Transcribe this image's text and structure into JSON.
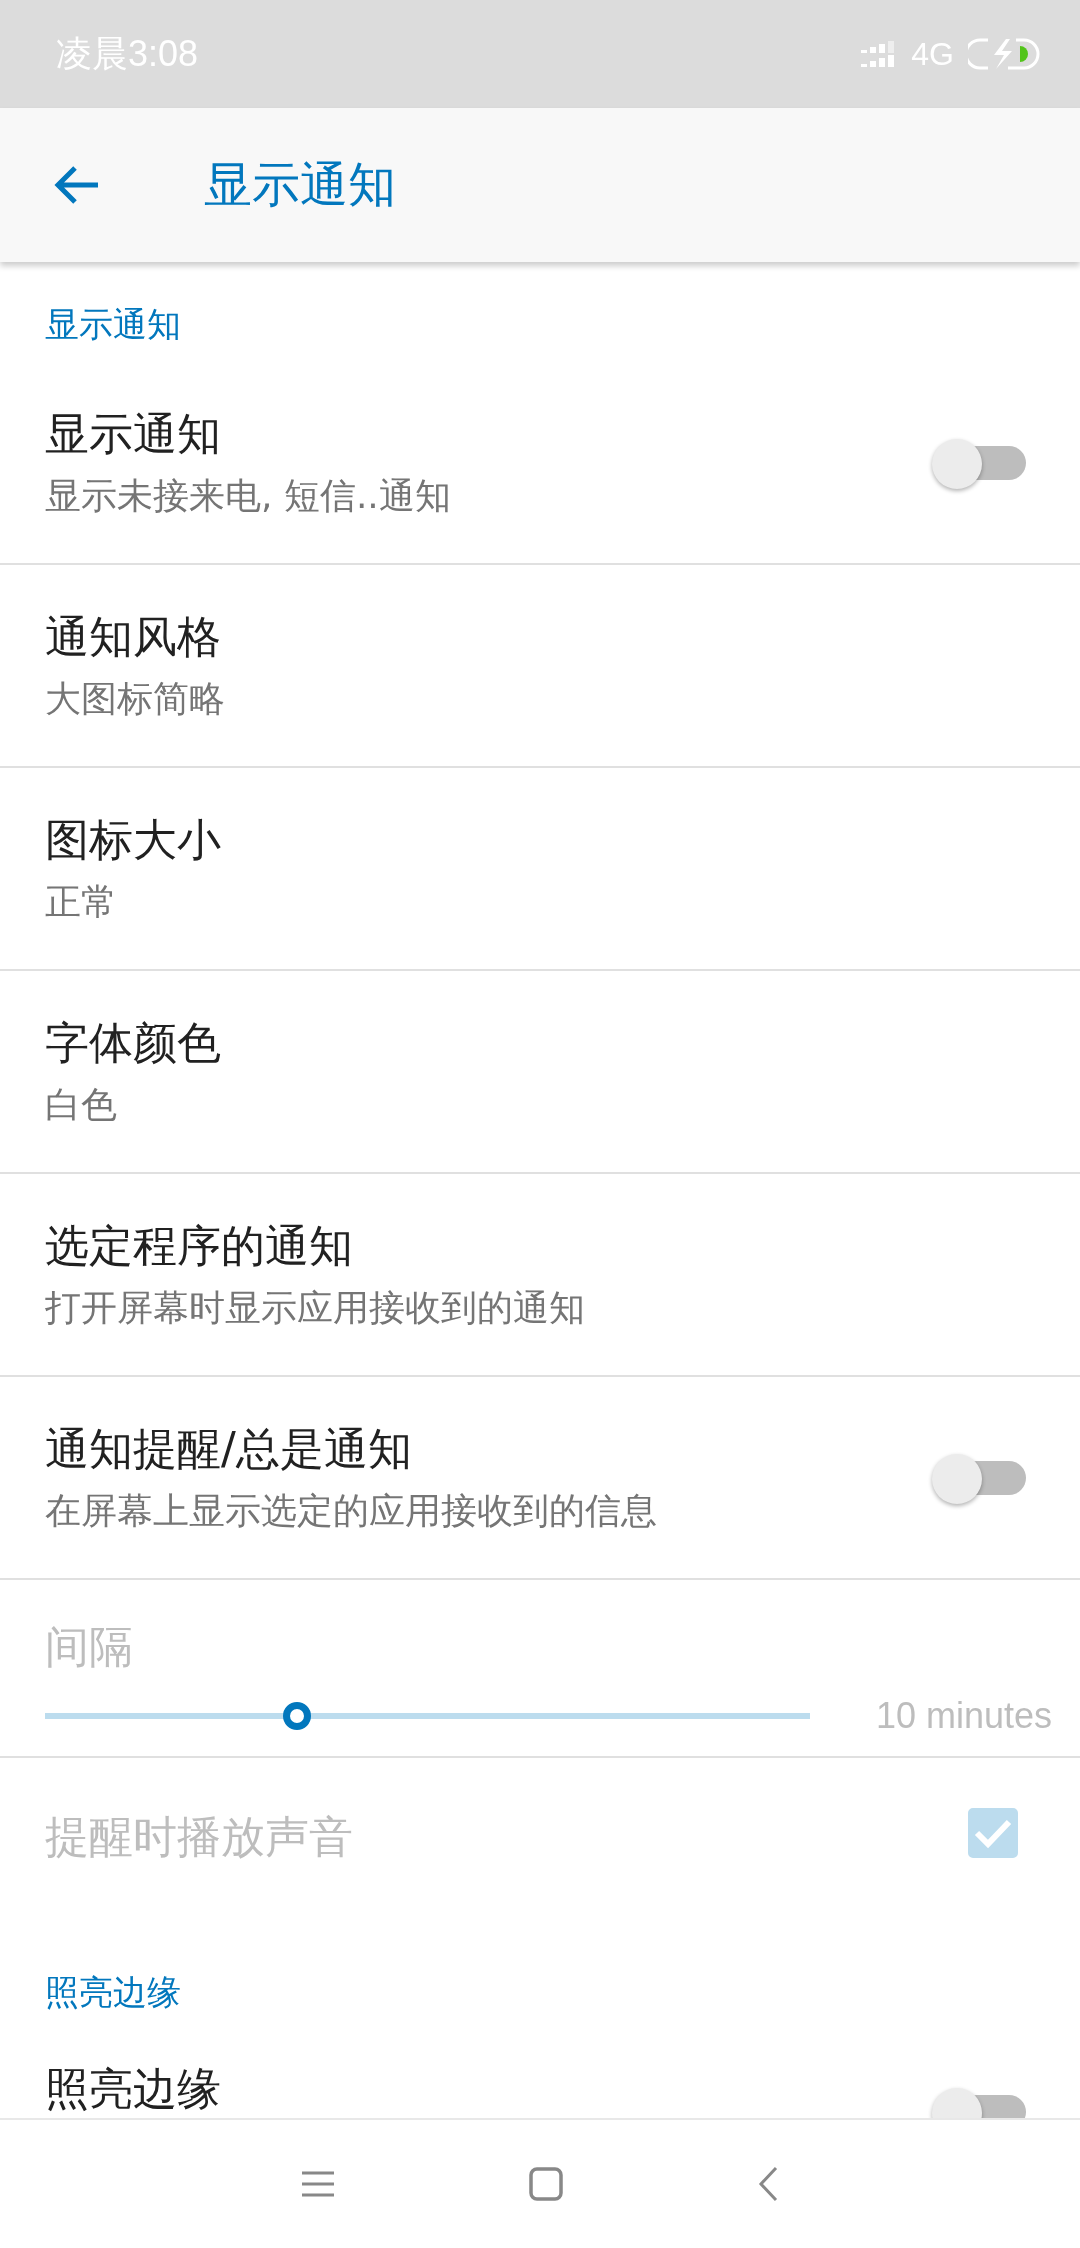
{
  "status_bar": {
    "time": "凌晨3:08",
    "network": "4G"
  },
  "app_bar": {
    "title": "显示通知"
  },
  "items": [
    {
      "kind": "header",
      "title": "显示通知"
    },
    {
      "kind": "switch",
      "title": "显示通知",
      "summary": "显示未接来电, 短信..通知",
      "on": false,
      "disabled": false
    },
    {
      "kind": "text",
      "title": "通知风格",
      "summary": "大图标简略",
      "disabled": false
    },
    {
      "kind": "text",
      "title": "图标大小",
      "summary": "正常",
      "disabled": false
    },
    {
      "kind": "text",
      "title": "字体颜色",
      "summary": "白色",
      "disabled": false
    },
    {
      "kind": "text",
      "title": "选定程序的通知",
      "summary": "打开屏幕时显示应用接收到的通知",
      "disabled": false
    },
    {
      "kind": "switch",
      "title": "通知提醒/总是通知",
      "summary": "在屏幕上显示选定的应用接收到的信息",
      "on": false,
      "disabled": false
    },
    {
      "kind": "slider",
      "title": "间隔",
      "level": 0.33,
      "reading": "10 minutes",
      "disabled": true
    },
    {
      "kind": "checkbox",
      "title": "提醒时播放声音",
      "checked": true,
      "disabled": true
    },
    {
      "kind": "header",
      "title": "照亮边缘"
    },
    {
      "kind": "switch",
      "title": "照亮边缘",
      "on": false,
      "disabled": false
    }
  ]
}
